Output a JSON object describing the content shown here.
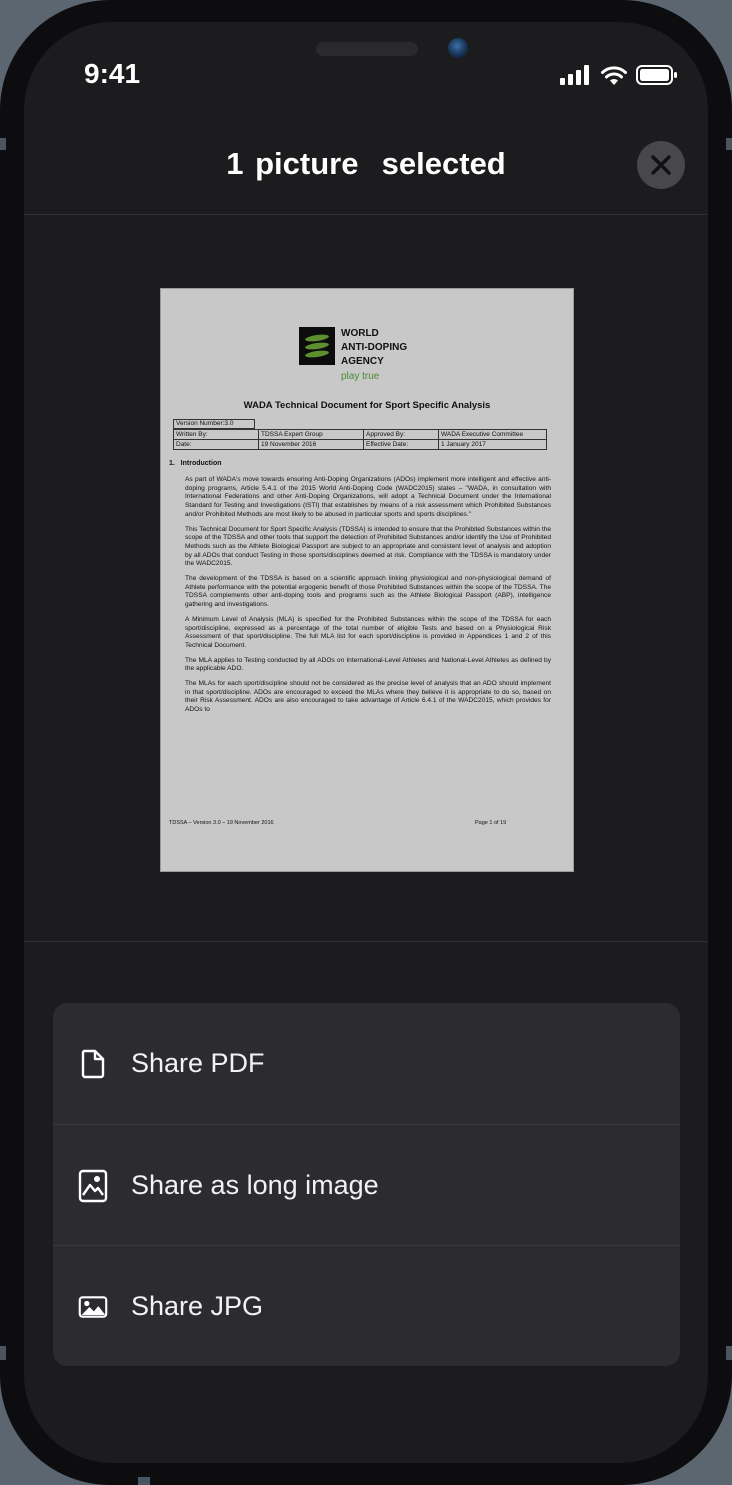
{
  "status_bar": {
    "time": "9:41"
  },
  "header": {
    "title": "1 picture  selected"
  },
  "document": {
    "org_lines": [
      "WORLD",
      "ANTI-DOPING",
      "AGENCY"
    ],
    "tagline": "play true",
    "title": "WADA Technical Document for Sport Specific Analysis",
    "version": "Version Number:3.0",
    "meta_rows": [
      [
        "Written By:",
        "TDSSA Expert Group",
        "Approved By:",
        "WADA Executive Committee"
      ],
      [
        "Date:",
        "19 November 2016",
        "Effective Date:",
        "1 January 2017"
      ]
    ],
    "section": "1.   Introduction",
    "paragraphs": [
      "As part of WADA's move towards ensuring Anti-Doping Organizations (ADOs) implement more intelligent and effective anti-doping programs, Article 5.4.1 of the 2015 World Anti-Doping Code (WADC2015) states – \"WADA, in consultation with International Federations and other Anti-Doping Organizations, will adopt a Technical Document under the International Standard for Testing and Investigations (ISTI) that establishes by means of a risk assessment which Prohibited Substances and/or Prohibited Methods are most likely to be abused in particular sports and sports disciplines.\"",
      "This Technical Document for Sport Specific Analysis (TDSSA) is intended to ensure that the Prohibited Substances within the scope of the TDSSA and other tools that support the detection of Prohibited Substances and/or identify the Use of Prohibited Methods such as the Athlete Biological Passport are subject to an appropriate and consistent level of analysis and adoption by all ADOs that conduct Testing in those sports/disciplines deemed at risk. Compliance with the TDSSA is mandatory under the WADC2015.",
      "The development of the TDSSA is based on a scientific approach linking physiological and non-physiological demand of Athlete performance with the potential ergogenic benefit of those Prohibited Substances within the scope of the TDSSA. The TDSSA complements other anti-doping tools and programs such as the Athlete Biological Passport (ABP), intelligence gathering and investigations.",
      "A Minimum Level of Analysis (MLA) is specified for the Prohibited Substances within the scope of the TDSSA for each sport/discipline, expressed as a percentage of the total number of eligible Tests and based on a Physiological Risk Assessment of that sport/discipline. The full MLA list for each sport/discipline is provided in Appendices 1 and 2 of this Technical Document.",
      "The MLA applies to Testing conducted by all ADOs on International-Level Athletes and National-Level Athletes as defined by the applicable ADO.",
      "The MLAs for each sport/discipline should not be considered as the precise level of analysis that an ADO should implement in that sport/discipline. ADOs are encouraged to exceed the MLAs where they believe it is appropriate to do so, based on their Risk Assessment. ADOs are also encouraged to take advantage of Article 6.4.1 of the WADC2015, which provides for ADOs to"
    ],
    "footer_left": "TDSSA – Version 3.0 – 19 November 2016",
    "footer_right": "Page 1 of 19"
  },
  "share_options": [
    {
      "label": "Share PDF",
      "icon": "file-icon"
    },
    {
      "label": "Share as long image",
      "icon": "long-image-icon"
    },
    {
      "label": "Share JPG",
      "icon": "image-icon"
    }
  ],
  "colors": {
    "background": "#1c1c1e",
    "panel": "#2c2c30",
    "text": "#ffffff",
    "logo_green": "#5c8f2e"
  }
}
